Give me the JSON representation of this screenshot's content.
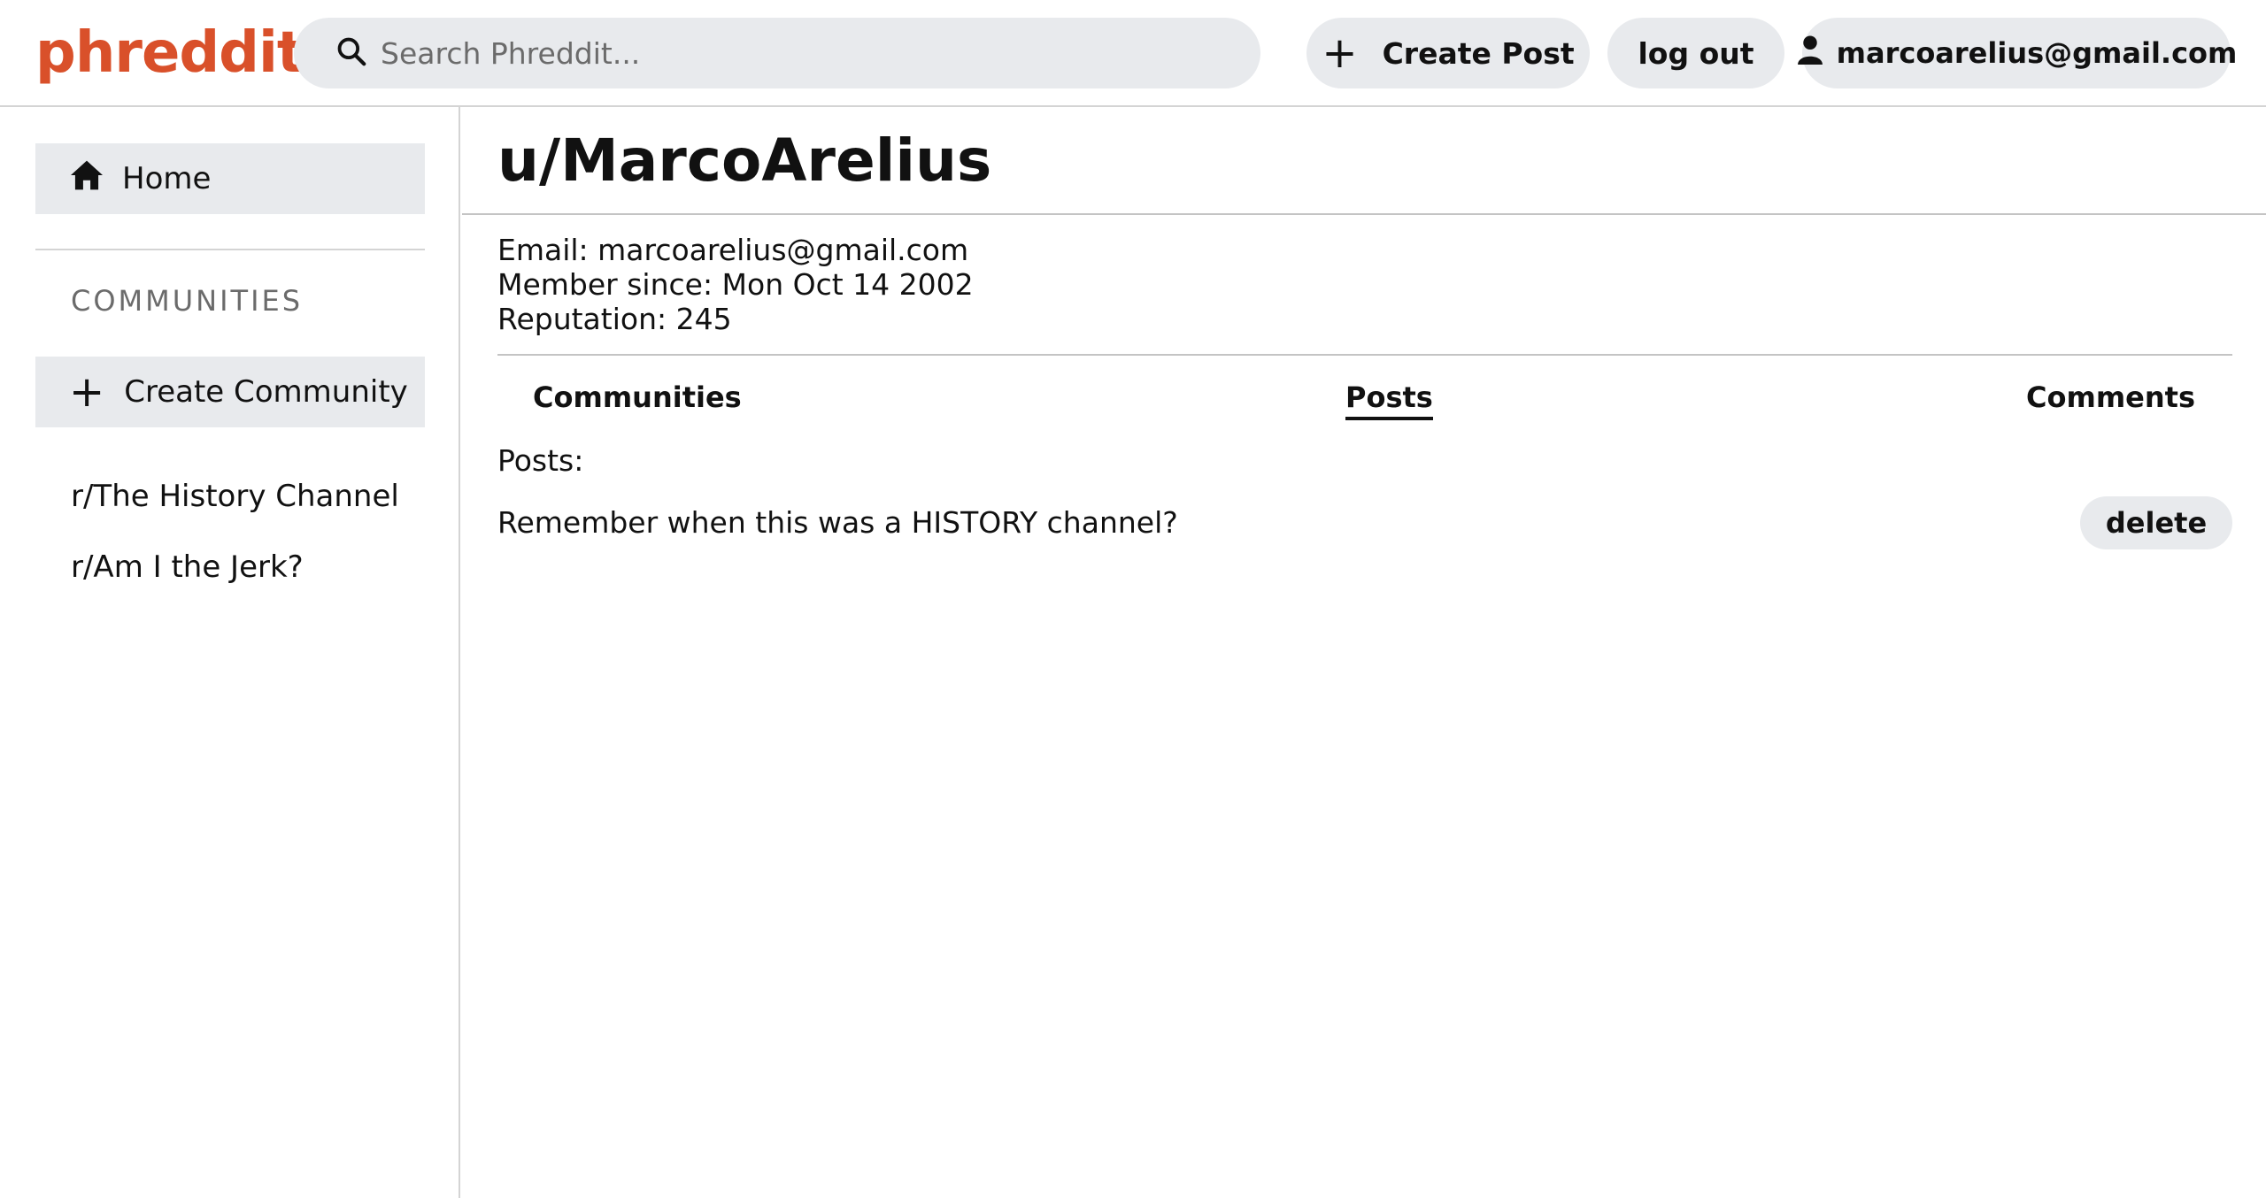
{
  "header": {
    "logo_text": "phreddit",
    "logo_color": "#d9502a",
    "search": {
      "placeholder": "Search Phreddit...",
      "value": "",
      "icon": "search-icon"
    },
    "create_post_label": "Create Post",
    "create_post_icon": "plus-icon",
    "logout_label": "log out",
    "user_label": "marcoarelius@gmail.com",
    "user_icon": "user-icon"
  },
  "sidebar": {
    "home_label": "Home",
    "home_icon": "home-icon",
    "communities_heading": "COMMUNITIES",
    "create_community_label": "Create Community",
    "create_community_icon": "plus-icon",
    "communities": [
      {
        "label": "r/The History Channel"
      },
      {
        "label": "r/Am I the Jerk?"
      }
    ]
  },
  "profile": {
    "title": "u/MarcoArelius",
    "email_line": "Email: marcoarelius@gmail.com",
    "member_since_line": "Member since: Mon Oct 14 2002",
    "reputation_line": "Reputation: 245"
  },
  "tabs": [
    {
      "label": "Communities",
      "active": false
    },
    {
      "label": "Posts",
      "active": true
    },
    {
      "label": "Comments",
      "active": false
    }
  ],
  "content": {
    "section_label": "Posts:",
    "posts": [
      {
        "title": "Remember when this was a HISTORY channel?",
        "delete_label": "delete"
      }
    ]
  }
}
